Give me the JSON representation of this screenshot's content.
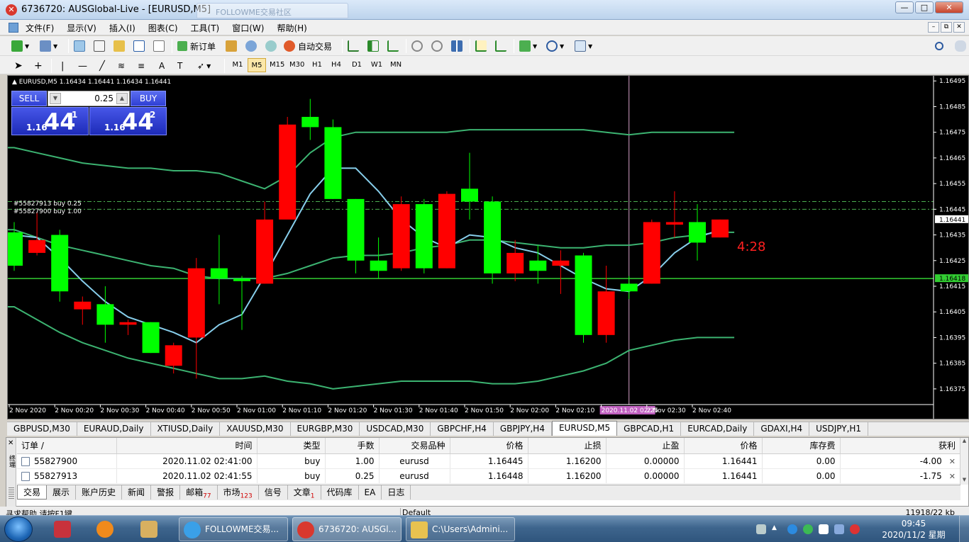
{
  "window": {
    "title": "6736720: AUSGlobal-Live - [EURUSD,M5]",
    "ghost_tab_text": "FOLLOWME交易社区",
    "controls": [
      "—",
      "□",
      "✕"
    ],
    "mdi_controls": [
      "–",
      "⧉",
      "✕"
    ]
  },
  "menu": {
    "items": [
      "文件(F)",
      "显示(V)",
      "插入(I)",
      "图表(C)",
      "工具(T)",
      "窗口(W)",
      "帮助(H)"
    ]
  },
  "toolbar": {
    "new_order_label": "新订单",
    "auto_trade_label": "自动交易"
  },
  "timeframes": [
    "M1",
    "M5",
    "M15",
    "M30",
    "H1",
    "H4",
    "D1",
    "W1",
    "MN"
  ],
  "active_timeframe": "M5",
  "chart": {
    "header": "▲ EURUSD,M5  1.16434 1.16441 1.16434 1.16441",
    "countdown": "4:28",
    "order_lines": [
      "#55827913 buy 0.25",
      "#55827900 buy 1.00"
    ],
    "crosshair_time": "2020.11.02 02:25",
    "current_price": "1.16441",
    "hline_price": "1.16418"
  },
  "chart_data": {
    "type": "candlestick",
    "symbol": "EURUSD",
    "timeframe": "M5",
    "ylim": [
      1.1637,
      1.16497
    ],
    "y_ticks": [
      1.16495,
      1.16485,
      1.16475,
      1.16465,
      1.16455,
      1.16445,
      1.16435,
      1.16425,
      1.16415,
      1.16405,
      1.16395,
      1.16385,
      1.16375
    ],
    "x_tick_labels": [
      "2 Nov 2020",
      "2 Nov 00:20",
      "2 Nov 00:30",
      "2 Nov 00:40",
      "2 Nov 00:50",
      "2 Nov 01:00",
      "2 Nov 01:10",
      "2 Nov 01:20",
      "2 Nov 01:30",
      "2 Nov 01:40",
      "2 Nov 01:50",
      "2 Nov 02:00",
      "2 Nov 02:10",
      "2020.11.02 02:25",
      "2 Nov 02:30",
      "2 Nov 02:40"
    ],
    "candles": [
      {
        "o": 1.16423,
        "h": 1.1644,
        "l": 1.16421,
        "c": 1.16436
      },
      {
        "o": 1.16433,
        "h": 1.16444,
        "l": 1.16427,
        "c": 1.16428
      },
      {
        "o": 1.16413,
        "h": 1.16437,
        "l": 1.16409,
        "c": 1.16435
      },
      {
        "o": 1.16409,
        "h": 1.16411,
        "l": 1.164,
        "c": 1.16406
      },
      {
        "o": 1.164,
        "h": 1.16415,
        "l": 1.16393,
        "c": 1.16408
      },
      {
        "o": 1.16401,
        "h": 1.16402,
        "l": 1.16396,
        "c": 1.164
      },
      {
        "o": 1.16389,
        "h": 1.16401,
        "l": 1.16389,
        "c": 1.16401
      },
      {
        "o": 1.16392,
        "h": 1.16393,
        "l": 1.16381,
        "c": 1.16384
      },
      {
        "o": 1.16422,
        "h": 1.16426,
        "l": 1.16379,
        "c": 1.16395
      },
      {
        "o": 1.16418,
        "h": 1.16435,
        "l": 1.16408,
        "c": 1.16422
      },
      {
        "o": 1.16417,
        "h": 1.16419,
        "l": 1.16398,
        "c": 1.16418
      },
      {
        "o": 1.16441,
        "h": 1.16448,
        "l": 1.16416,
        "c": 1.16416
      },
      {
        "o": 1.16478,
        "h": 1.16481,
        "l": 1.16445,
        "c": 1.16441
      },
      {
        "o": 1.16477,
        "h": 1.16488,
        "l": 1.16472,
        "c": 1.16481
      },
      {
        "o": 1.16449,
        "h": 1.1648,
        "l": 1.16449,
        "c": 1.16477
      },
      {
        "o": 1.16425,
        "h": 1.16449,
        "l": 1.1642,
        "c": 1.16449
      },
      {
        "o": 1.16421,
        "h": 1.16434,
        "l": 1.16418,
        "c": 1.16425
      },
      {
        "o": 1.16447,
        "h": 1.1645,
        "l": 1.16421,
        "c": 1.16422
      },
      {
        "o": 1.16422,
        "h": 1.16449,
        "l": 1.1642,
        "c": 1.16447
      },
      {
        "o": 1.16451,
        "h": 1.16452,
        "l": 1.16422,
        "c": 1.16422
      },
      {
        "o": 1.16448,
        "h": 1.16467,
        "l": 1.16441,
        "c": 1.16453
      },
      {
        "o": 1.1642,
        "h": 1.1645,
        "l": 1.16416,
        "c": 1.16448
      },
      {
        "o": 1.16428,
        "h": 1.16433,
        "l": 1.16417,
        "c": 1.1642
      },
      {
        "o": 1.16421,
        "h": 1.16431,
        "l": 1.16416,
        "c": 1.16425
      },
      {
        "o": 1.16425,
        "h": 1.16429,
        "l": 1.16412,
        "c": 1.16423
      },
      {
        "o": 1.16396,
        "h": 1.16428,
        "l": 1.16393,
        "c": 1.16427
      },
      {
        "o": 1.16413,
        "h": 1.16423,
        "l": 1.16393,
        "c": 1.16396
      },
      {
        "o": 1.16413,
        "h": 1.16419,
        "l": 1.1641,
        "c": 1.16416
      },
      {
        "o": 1.1644,
        "h": 1.16441,
        "l": 1.16416,
        "c": 1.16416
      },
      {
        "o": 1.1644,
        "h": 1.16452,
        "l": 1.16434,
        "c": 1.16439
      },
      {
        "o": 1.16432,
        "h": 1.16447,
        "l": 1.16425,
        "c": 1.1644
      },
      {
        "o": 1.16441,
        "h": 1.16441,
        "l": 1.16434,
        "c": 1.16434
      }
    ],
    "bollinger_upper": [
      1.16469,
      1.16467,
      1.16465,
      1.16463,
      1.16462,
      1.16461,
      1.16461,
      1.1646,
      1.1646,
      1.16459,
      1.16456,
      1.16453,
      1.16458,
      1.16467,
      1.16473,
      1.16475,
      1.16475,
      1.16475,
      1.16475,
      1.16475,
      1.16476,
      1.16476,
      1.16476,
      1.16476,
      1.16476,
      1.16476,
      1.16475,
      1.16474,
      1.16475,
      1.16475,
      1.16475,
      1.16475
    ],
    "bollinger_middle": [
      1.16437,
      1.16434,
      1.16431,
      1.16429,
      1.16427,
      1.16425,
      1.16423,
      1.16422,
      1.16419,
      1.16418,
      1.16418,
      1.16418,
      1.1642,
      1.16423,
      1.16426,
      1.16427,
      1.16427,
      1.16428,
      1.1643,
      1.16431,
      1.16433,
      1.16433,
      1.16432,
      1.16431,
      1.1643,
      1.1643,
      1.16431,
      1.16431,
      1.16432,
      1.16434,
      1.16435,
      1.16436
    ],
    "bollinger_lower": [
      1.16407,
      1.16402,
      1.16397,
      1.16393,
      1.1639,
      1.16387,
      1.16385,
      1.16383,
      1.16381,
      1.16379,
      1.16379,
      1.1638,
      1.16378,
      1.16377,
      1.16375,
      1.16376,
      1.16377,
      1.16378,
      1.16378,
      1.16378,
      1.16378,
      1.16377,
      1.16377,
      1.16378,
      1.1638,
      1.16382,
      1.16385,
      1.1639,
      1.16392,
      1.16394,
      1.16395,
      1.16395
    ],
    "ma_fast": [
      1.16435,
      1.16434,
      1.16426,
      1.16417,
      1.16409,
      1.16403,
      1.164,
      1.16397,
      1.16393,
      1.164,
      1.16404,
      1.16419,
      1.16435,
      1.16451,
      1.16461,
      1.16461,
      1.16452,
      1.16441,
      1.16434,
      1.1643,
      1.16435,
      1.16434,
      1.1643,
      1.16428,
      1.16423,
      1.16418,
      1.16414,
      1.16413,
      1.16419,
      1.16428,
      1.16434,
      1.16437
    ]
  },
  "chart_tabs": [
    "GBPUSD,M30",
    "EURAUD,Daily",
    "XTIUSD,Daily",
    "XAUUSD,M30",
    "EURGBP,M30",
    "USDCAD,M30",
    "GBPCHF,H4",
    "GBPJPY,H4",
    "EURUSD,M5",
    "GBPCAD,H1",
    "EURCAD,Daily",
    "GDAXI,H4",
    "USDJPY,H1"
  ],
  "active_chart_tab": "EURUSD,M5",
  "trade_panel": {
    "sell_label": "SELL",
    "buy_label": "BUY",
    "lot": "0.25",
    "sell_price_small": "1.16",
    "sell_price_big": "44",
    "sell_price_sup": "1",
    "buy_price_small": "1.16",
    "buy_price_big": "44",
    "buy_price_sup": "2"
  },
  "orders": {
    "columns": [
      "订单 /",
      "时间",
      "类型",
      "手数",
      "交易品种",
      "价格",
      "止损",
      "止盈",
      "价格",
      "库存费",
      "获利"
    ],
    "rows": [
      [
        "55827900",
        "2020.11.02 02:41:00",
        "buy",
        "1.00",
        "eurusd",
        "1.16445",
        "1.16200",
        "0.00000",
        "1.16441",
        "0.00",
        "-4.00"
      ],
      [
        "55827913",
        "2020.11.02 02:41:55",
        "buy",
        "0.25",
        "eurusd",
        "1.16448",
        "1.16200",
        "0.00000",
        "1.16441",
        "0.00",
        "-1.75"
      ]
    ]
  },
  "terminal_tabs": [
    {
      "label": "交易",
      "badge": ""
    },
    {
      "label": "展示",
      "badge": ""
    },
    {
      "label": "账户历史",
      "badge": ""
    },
    {
      "label": "新闻",
      "badge": ""
    },
    {
      "label": "警报",
      "badge": ""
    },
    {
      "label": "邮箱",
      "badge": "77"
    },
    {
      "label": "市场",
      "badge": "123"
    },
    {
      "label": "信号",
      "badge": ""
    },
    {
      "label": "文章",
      "badge": "1"
    },
    {
      "label": "代码库",
      "badge": ""
    },
    {
      "label": "EA",
      "badge": ""
    },
    {
      "label": "日志",
      "badge": ""
    }
  ],
  "side_label": "终端",
  "statusbar": {
    "help": "寻求帮助,请按F1键",
    "profile": "Default",
    "traffic": "11918/22 kb"
  },
  "taskbar": {
    "windows": [
      "FOLLOWME交易...",
      "6736720: AUSGl...",
      "C:\\Users\\Admini..."
    ],
    "clock_time": "09:45",
    "clock_date": "2020/11/2 星期一"
  },
  "colors": {
    "bull": "#00ff00",
    "bear": "#ff0000",
    "bollinger": "#3cb371",
    "ma": "#87ceeb",
    "hline": "#32cd32",
    "countdown": "#ff2020"
  }
}
